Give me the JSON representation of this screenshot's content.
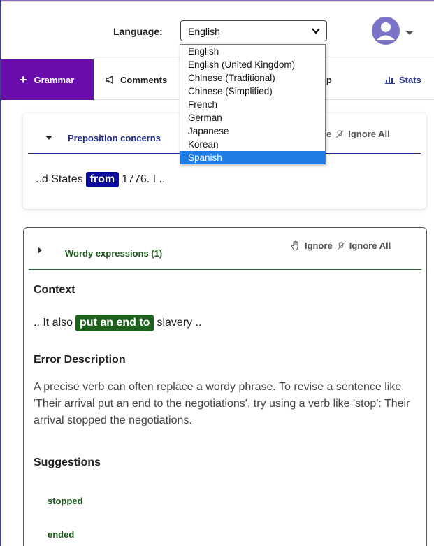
{
  "header": {
    "language_label": "Language:",
    "language_selected": "English"
  },
  "language_options": [
    "English",
    "English (United Kingdom)",
    "Chinese (Traditional)",
    "Chinese (Simplified)",
    "French",
    "German",
    "Japanese",
    "Korean",
    "Spanish"
  ],
  "highlighted_option": "Spanish",
  "tabs": {
    "grammar": "Grammar",
    "comments": "Comments",
    "help": "elp",
    "stats": "Stats"
  },
  "card1": {
    "title": "Preposition concerns",
    "ignore": "ore",
    "ignore_all": "Ignore All",
    "context_before": "..d States",
    "context_highlight": "from",
    "context_after": "1776. I .."
  },
  "card2": {
    "title": "Wordy expressions (1)",
    "ignore": "Ignore",
    "ignore_all": "Ignore All",
    "context_heading": "Context",
    "context_before": ".. It also",
    "context_highlight": "put an end to",
    "context_after": "slavery ..",
    "error_heading": "Error Description",
    "error_text": "A precise verb can often replace a wordy phrase. To revise a sentence like 'Their arrival put an end to the negotiations', try using a verb like 'stop': Their arrival stopped the negotiations.",
    "suggestions_heading": "Suggestions",
    "suggestions": [
      "stopped",
      "ended"
    ]
  },
  "colors": {
    "grammar_tab": "#6a0dad",
    "avatar": "#7a73c7",
    "highlight_blue": "#0a0a9c",
    "highlight_green": "#1e5f1e",
    "dropdown_selected": "#1e7ce6"
  }
}
